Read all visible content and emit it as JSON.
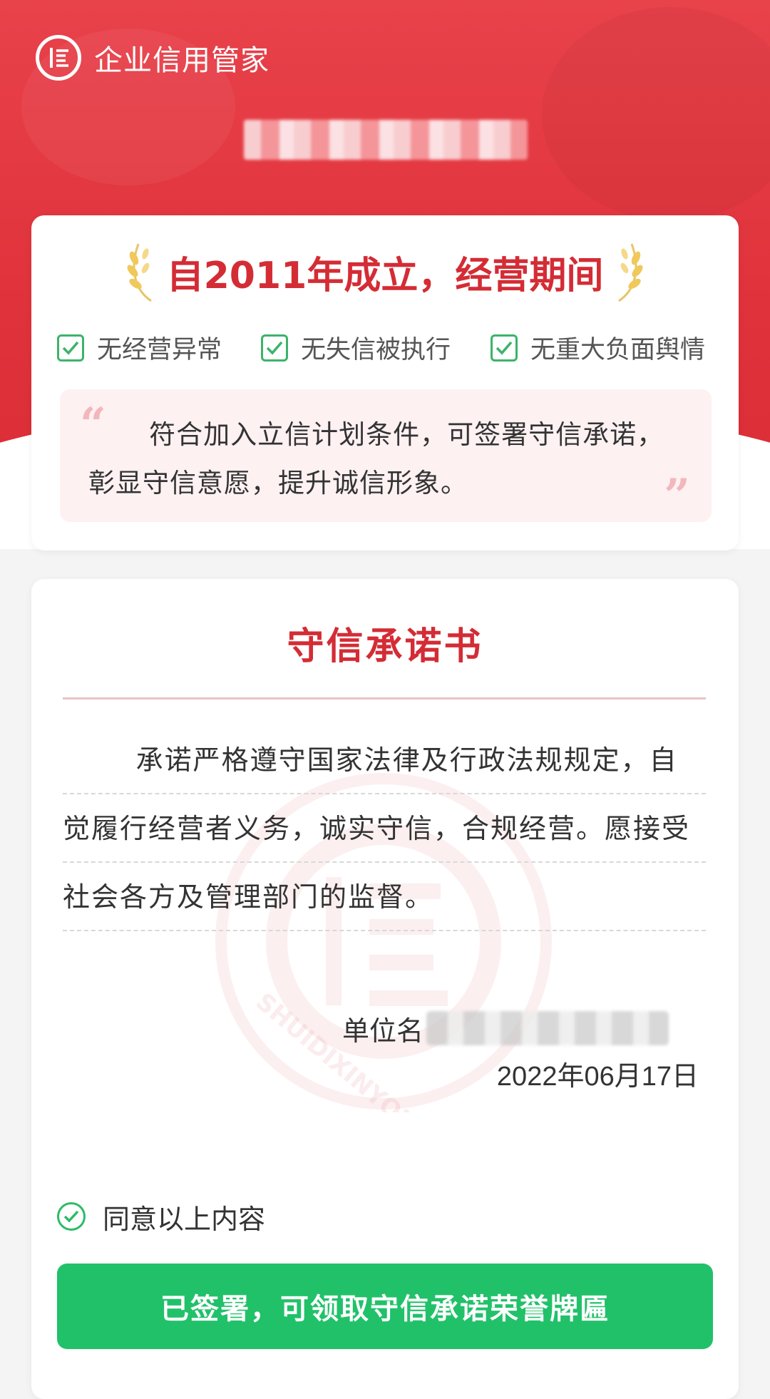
{
  "header": {
    "app_name": "企业信用管家",
    "logo_icon": "credit-logo-icon"
  },
  "summary": {
    "established_title": "自2011年成立，经营期间",
    "checks": [
      {
        "label": "无经营异常"
      },
      {
        "label": "无失信被执行"
      },
      {
        "label": "无重大负面舆情"
      }
    ],
    "quote_text": "符合加入立信计划条件，可签署守信承诺，彰显守信意愿，提升诚信形象。",
    "quote_open": "“",
    "quote_close": "”"
  },
  "letter": {
    "title": "守信承诺书",
    "body": "承诺严格遵守国家法律及行政法规规定，自觉履行经营者义务，诚实守信，合规经营。愿接受社会各方及管理部门的监督。",
    "unit_label": "单位名",
    "date": "2022年06月17日",
    "watermark_text": "SHUIDIXINYONG"
  },
  "footer": {
    "agree_label": "同意以上内容",
    "button_label": "已签署，可领取守信承诺荣誉牌匾"
  },
  "colors": {
    "brand_red": "#e0323b",
    "title_red": "#d42c35",
    "check_green": "#3cb36a",
    "button_green": "#21c16a"
  }
}
